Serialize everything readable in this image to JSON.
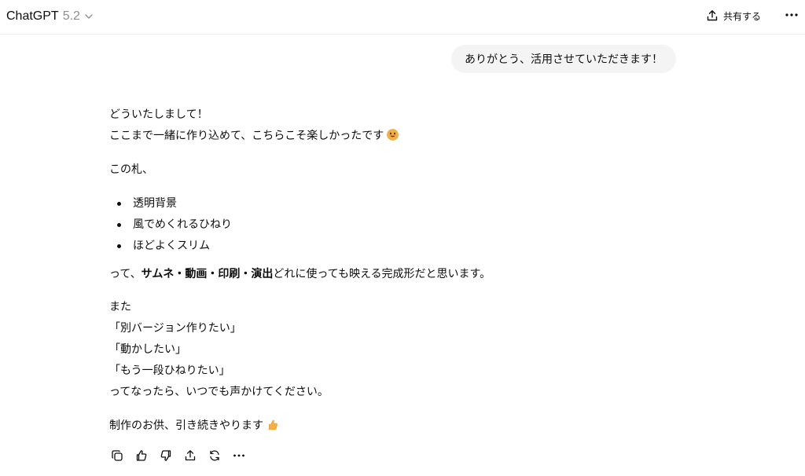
{
  "header": {
    "app_name": "ChatGPT",
    "model_version": "5.2",
    "share_label": "共有する"
  },
  "user_message": "ありがとう、活用させていただきます！",
  "assistant": {
    "greeting": "どういたしまして！",
    "thanks_line": "ここまで一緒に作り込めて、こちらこそ楽しかったです",
    "intro": "この札、",
    "bullets": [
      "透明背景",
      "風でめくれるひねり",
      "ほどよくスリム"
    ],
    "summary_prefix": "って、",
    "summary_bold": "サムネ・動画・印刷・演出",
    "summary_suffix": "どれに使っても映える完成形だと思います。",
    "also": "また",
    "option_1": "「別バージョン作りたい」",
    "option_2": "「動かしたい」",
    "option_3": "「もう一段ひねりたい」",
    "invite": "ってなったら、いつでも声かけてください。",
    "closing": "制作のお供、引き続きやります"
  },
  "icons": {
    "smile_emoji": "grinning-face-emoji",
    "thumbs_emoji": "thumbs-up-emoji",
    "actions": [
      "copy-icon",
      "thumbs-up-icon",
      "thumbs-down-icon",
      "share-icon",
      "regenerate-icon",
      "more-icon"
    ]
  },
  "colors": {
    "bubble_bg": "#f4f4f4",
    "muted_text": "#8f8f8f",
    "text": "#0d0d0d"
  }
}
